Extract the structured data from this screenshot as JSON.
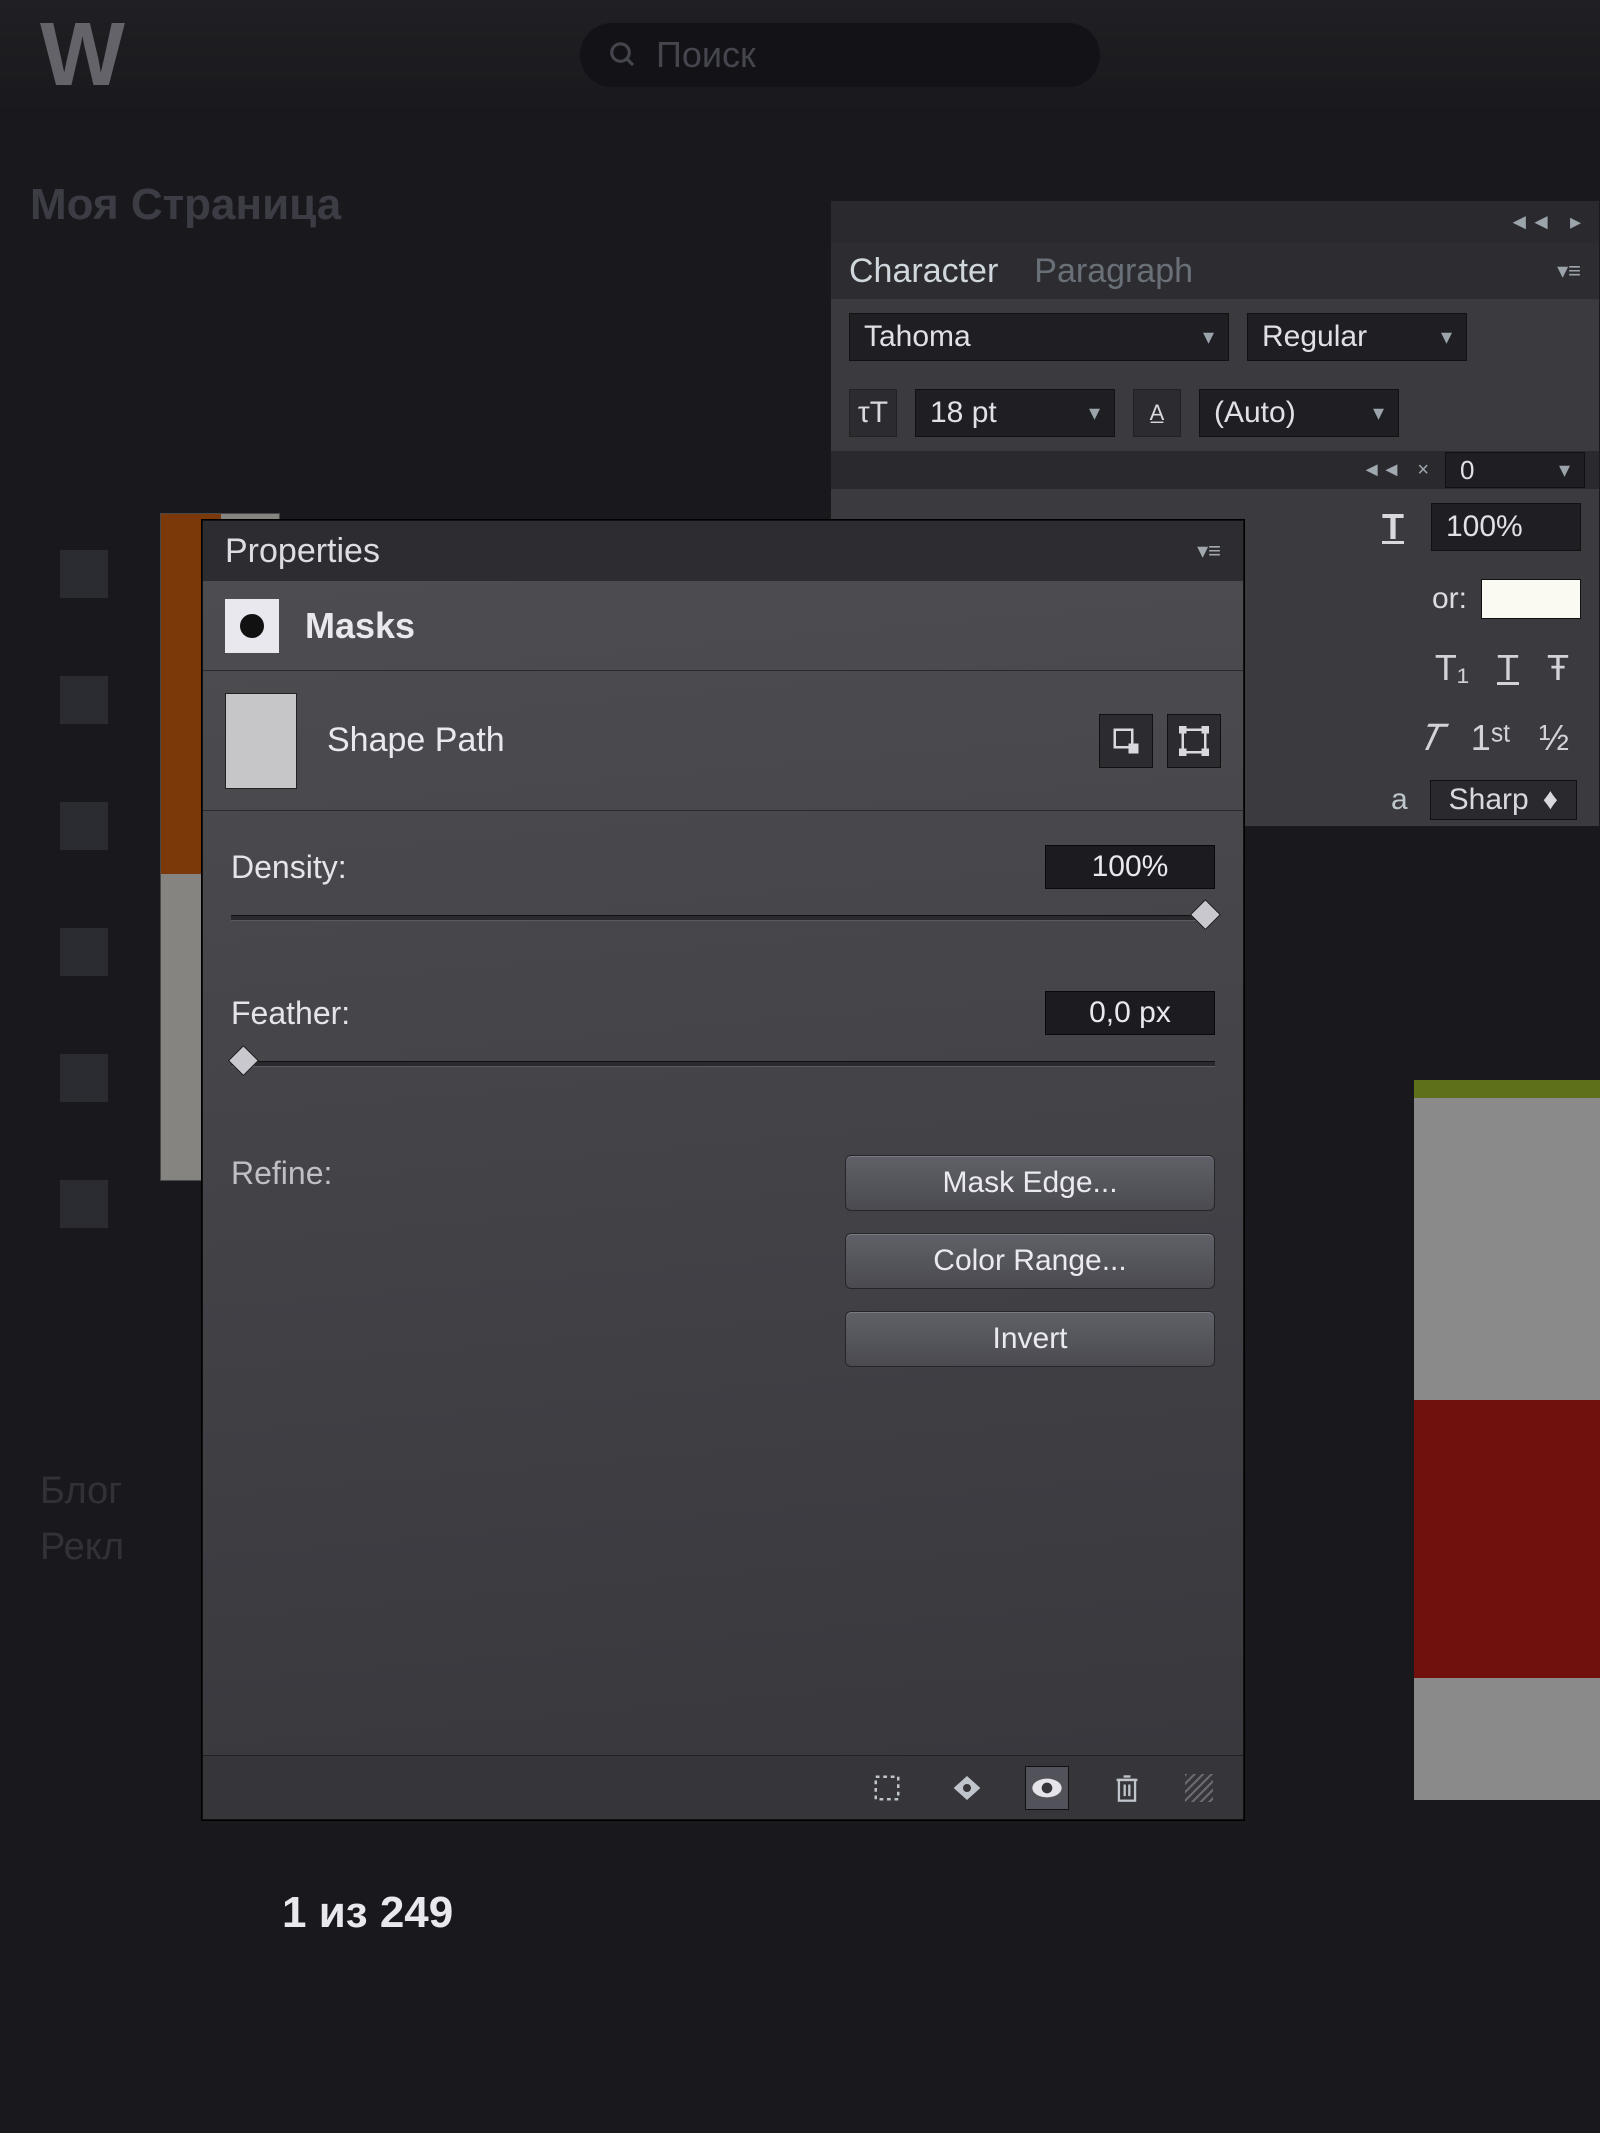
{
  "vk": {
    "search_placeholder": "Поиск",
    "page_title": "Моя Страница",
    "side1": "Блог",
    "side2": "Рекл",
    "counter": "1 из 249"
  },
  "character": {
    "tab_character": "Character",
    "tab_paragraph": "Paragraph",
    "font": "Tahoma",
    "style": "Regular",
    "size": "18 pt",
    "leading": "(Auto)",
    "tracking": "0",
    "scale": "100%",
    "color_label": "or:",
    "aa_label": "a",
    "aa_value": "Sharp",
    "t1": "T₁",
    "t2": "T",
    "t3": "Ŧ",
    "it": "𝑇",
    "st": "1ˢᵗ",
    "half": "½"
  },
  "props": {
    "title": "Properties",
    "masks": "Masks",
    "shape": "Shape Path",
    "density_label": "Density:",
    "density_value": "100%",
    "feather_label": "Feather:",
    "feather_value": "0,0 px",
    "refine_label": "Refine:",
    "btn_edge": "Mask Edge...",
    "btn_color": "Color Range...",
    "btn_invert": "Invert"
  }
}
